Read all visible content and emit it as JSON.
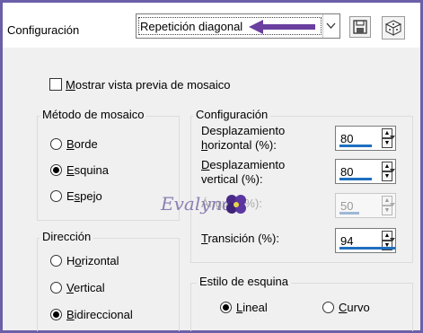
{
  "header": {
    "label": "Configuración",
    "preset_value": "Repetición diagonal",
    "arrow_color": "#6a3fa0",
    "save_icon": "floppy-disk-icon",
    "random_icon": "dice-icon"
  },
  "preview_checkbox": {
    "label": "Mostrar vista previa de mosaico",
    "checked": false
  },
  "tile_method": {
    "title": "Método de mosaico",
    "options": [
      {
        "label": "Borde",
        "selected": false
      },
      {
        "label": "Esquina",
        "selected": true
      },
      {
        "label": "Espejo",
        "selected": false
      }
    ]
  },
  "direction": {
    "title": "Dirección",
    "options": [
      {
        "label": "Horizontal",
        "selected": false
      },
      {
        "label": "Vertical",
        "selected": false
      },
      {
        "label": "Bidireccional",
        "selected": true
      }
    ]
  },
  "settings": {
    "title": "Configuración",
    "h_offset": {
      "label_line1": "Desplazamiento",
      "label_line2": "horizontal (%):",
      "value": "80",
      "fill": 0.8
    },
    "v_offset": {
      "label_line1": "Desplazamiento",
      "label_line2": "vertical (%):",
      "value": "80",
      "fill": 0.8
    },
    "angle": {
      "label": "Ángulo (%):",
      "value": "50",
      "fill": 0.5,
      "enabled": false
    },
    "transition": {
      "label": "Transición (%):",
      "value": "94",
      "fill": 0.94
    }
  },
  "corner_style": {
    "title": "Estilo de esquina",
    "options": [
      {
        "label": "Lineal",
        "selected": true
      },
      {
        "label": "Curvo",
        "selected": false
      }
    ]
  },
  "watermark": {
    "text": "Evalynda"
  },
  "colors": {
    "accent": "#1f6fbf",
    "frame": "#6b5fa8"
  }
}
